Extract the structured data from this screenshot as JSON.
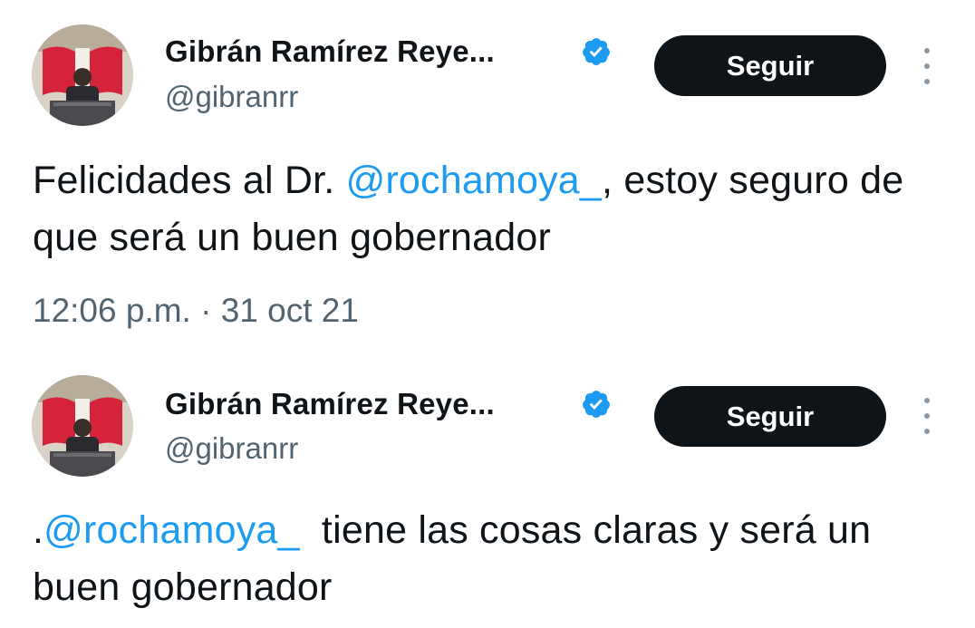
{
  "colors": {
    "text": "#0f1419",
    "secondary": "#536471",
    "mention": "#1d9bf0",
    "verified": "#1d9bf0",
    "follow_bg": "#0f1419",
    "follow_text": "#ffffff"
  },
  "tweets": [
    {
      "display_name": "Gibrán Ramírez Reye...",
      "handle": "@gibranrr",
      "verified_icon": "verified-badge-icon",
      "follow_label": "Seguir",
      "more_icon": "more-vertical-icon",
      "text_before": "Felicidades al Dr. ",
      "mention": "@rochamoya_",
      "text_after": ", estoy seguro de que será un buen gobernador",
      "timestamp": "12:06 p.m. · 31 oct 21"
    },
    {
      "display_name": "Gibrán Ramírez Reye...",
      "handle": "@gibranrr",
      "verified_icon": "verified-badge-icon",
      "follow_label": "Seguir",
      "more_icon": "more-vertical-icon",
      "text_before": ".",
      "mention": "@rochamoya_",
      "text_after": "  tiene las cosas claras y será un buen gobernador"
    }
  ]
}
